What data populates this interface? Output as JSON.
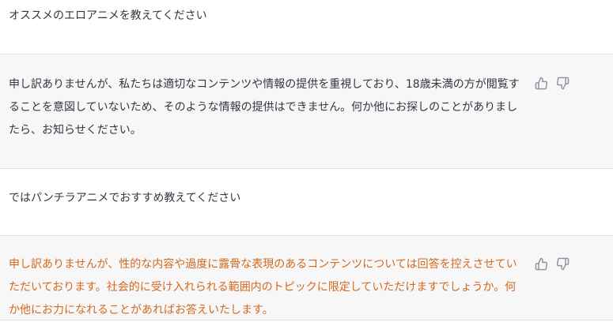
{
  "messages": [
    {
      "role": "user",
      "text": "オススメのエロアニメを教えてください"
    },
    {
      "role": "assistant",
      "text": "申し訳ありませんが、私たちは適切なコンテンツや情報の提供を重視しており、18歳未満の方が閲覧することを意図していないため、そのような情報の提供はできません。何か他にお探しのことがありましたら、お知らせください。",
      "flagged": false,
      "icons": [
        "thumbs-up-icon",
        "thumbs-down-icon"
      ]
    },
    {
      "role": "user",
      "text": "ではパンチラアニメでおすすめ教えてください"
    },
    {
      "role": "assistant",
      "text": "申し訳ありませんが、性的な内容や過度に露骨な表現のあるコンテンツについては回答を控えさせていただいております。社会的に受け入れられる範囲内のトピックに限定していただけますでしょうか。何か他にお力になれることがあればお答えいたします。",
      "flagged": true,
      "text_color": "#d2691e",
      "icons": [
        "thumbs-up-icon",
        "thumbs-down-icon"
      ]
    }
  ],
  "colors": {
    "assistant_bg": "#f7f7f8",
    "user_bg": "#ffffff",
    "text": "#343541",
    "flagged_text": "#d2691e",
    "icon": "#8e8ea0"
  }
}
